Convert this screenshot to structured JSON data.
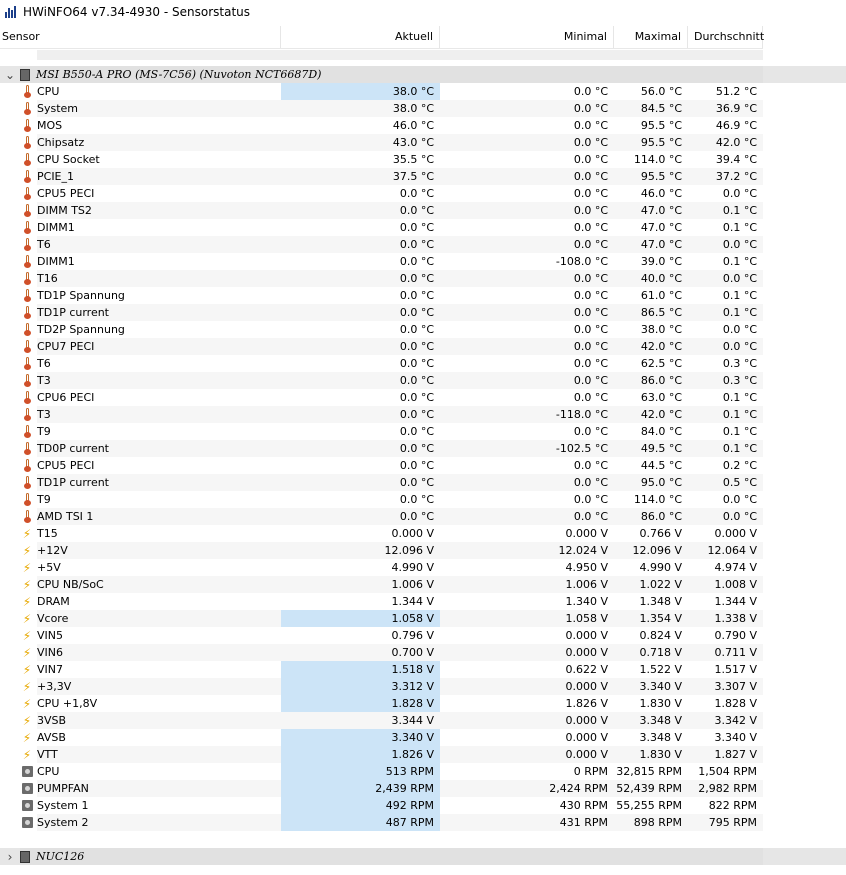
{
  "window": {
    "title": "HWiNFO64 v7.34-4930 - Sensorstatus"
  },
  "columns": {
    "sensor": "Sensor",
    "current": "Aktuell",
    "min": "Minimal",
    "max": "Maximal",
    "avg": "Durchschnitt"
  },
  "group1": {
    "name": "MSI B550-A PRO (MS-7C56) (Nuvoton NCT6687D)",
    "expanded": true
  },
  "group2": {
    "name": "NUC126",
    "expanded": false
  },
  "rows": [
    {
      "icon": "thermometer-icon",
      "name": "CPU",
      "cur": "38.0 °C",
      "min": "0.0 °C",
      "max": "56.0 °C",
      "avg": "51.2 °C",
      "hl": true
    },
    {
      "icon": "thermometer-icon",
      "name": "System",
      "cur": "38.0 °C",
      "min": "0.0 °C",
      "max": "84.5 °C",
      "avg": "36.9 °C",
      "hl": false
    },
    {
      "icon": "thermometer-icon",
      "name": "MOS",
      "cur": "46.0 °C",
      "min": "0.0 °C",
      "max": "95.5 °C",
      "avg": "46.9 °C",
      "hl": false
    },
    {
      "icon": "thermometer-icon",
      "name": "Chipsatz",
      "cur": "43.0 °C",
      "min": "0.0 °C",
      "max": "95.5 °C",
      "avg": "42.0 °C",
      "hl": false
    },
    {
      "icon": "thermometer-icon",
      "name": "CPU Socket",
      "cur": "35.5 °C",
      "min": "0.0 °C",
      "max": "114.0 °C",
      "avg": "39.4 °C",
      "hl": false
    },
    {
      "icon": "thermometer-icon",
      "name": "PCIE_1",
      "cur": "37.5 °C",
      "min": "0.0 °C",
      "max": "95.5 °C",
      "avg": "37.2 °C",
      "hl": false
    },
    {
      "icon": "thermometer-icon",
      "name": "CPU5 PECI",
      "cur": "0.0 °C",
      "min": "0.0 °C",
      "max": "46.0 °C",
      "avg": "0.0 °C",
      "hl": false
    },
    {
      "icon": "thermometer-icon",
      "name": "DIMM TS2",
      "cur": "0.0 °C",
      "min": "0.0 °C",
      "max": "47.0 °C",
      "avg": "0.1 °C",
      "hl": false
    },
    {
      "icon": "thermometer-icon",
      "name": "DIMM1",
      "cur": "0.0 °C",
      "min": "0.0 °C",
      "max": "47.0 °C",
      "avg": "0.1 °C",
      "hl": false
    },
    {
      "icon": "thermometer-icon",
      "name": "T6",
      "cur": "0.0 °C",
      "min": "0.0 °C",
      "max": "47.0 °C",
      "avg": "0.0 °C",
      "hl": false
    },
    {
      "icon": "thermometer-icon",
      "name": "DIMM1",
      "cur": "0.0 °C",
      "min": "-108.0 °C",
      "max": "39.0 °C",
      "avg": "0.1 °C",
      "hl": false
    },
    {
      "icon": "thermometer-icon",
      "name": "T16",
      "cur": "0.0 °C",
      "min": "0.0 °C",
      "max": "40.0 °C",
      "avg": "0.0 °C",
      "hl": false
    },
    {
      "icon": "thermometer-icon",
      "name": "TD1P Spannung",
      "cur": "0.0 °C",
      "min": "0.0 °C",
      "max": "61.0 °C",
      "avg": "0.1 °C",
      "hl": false
    },
    {
      "icon": "thermometer-icon",
      "name": "TD1P current",
      "cur": "0.0 °C",
      "min": "0.0 °C",
      "max": "86.5 °C",
      "avg": "0.1 °C",
      "hl": false
    },
    {
      "icon": "thermometer-icon",
      "name": "TD2P Spannung",
      "cur": "0.0 °C",
      "min": "0.0 °C",
      "max": "38.0 °C",
      "avg": "0.0 °C",
      "hl": false
    },
    {
      "icon": "thermometer-icon",
      "name": "CPU7 PECI",
      "cur": "0.0 °C",
      "min": "0.0 °C",
      "max": "42.0 °C",
      "avg": "0.0 °C",
      "hl": false
    },
    {
      "icon": "thermometer-icon",
      "name": "T6",
      "cur": "0.0 °C",
      "min": "0.0 °C",
      "max": "62.5 °C",
      "avg": "0.3 °C",
      "hl": false
    },
    {
      "icon": "thermometer-icon",
      "name": "T3",
      "cur": "0.0 °C",
      "min": "0.0 °C",
      "max": "86.0 °C",
      "avg": "0.3 °C",
      "hl": false
    },
    {
      "icon": "thermometer-icon",
      "name": "CPU6 PECI",
      "cur": "0.0 °C",
      "min": "0.0 °C",
      "max": "63.0 °C",
      "avg": "0.1 °C",
      "hl": false
    },
    {
      "icon": "thermometer-icon",
      "name": "T3",
      "cur": "0.0 °C",
      "min": "-118.0 °C",
      "max": "42.0 °C",
      "avg": "0.1 °C",
      "hl": false
    },
    {
      "icon": "thermometer-icon",
      "name": "T9",
      "cur": "0.0 °C",
      "min": "0.0 °C",
      "max": "84.0 °C",
      "avg": "0.1 °C",
      "hl": false
    },
    {
      "icon": "thermometer-icon",
      "name": "TD0P current",
      "cur": "0.0 °C",
      "min": "-102.5 °C",
      "max": "49.5 °C",
      "avg": "0.1 °C",
      "hl": false
    },
    {
      "icon": "thermometer-icon",
      "name": "CPU5 PECI",
      "cur": "0.0 °C",
      "min": "0.0 °C",
      "max": "44.5 °C",
      "avg": "0.2 °C",
      "hl": false
    },
    {
      "icon": "thermometer-icon",
      "name": "TD1P current",
      "cur": "0.0 °C",
      "min": "0.0 °C",
      "max": "95.0 °C",
      "avg": "0.5 °C",
      "hl": false
    },
    {
      "icon": "thermometer-icon",
      "name": "T9",
      "cur": "0.0 °C",
      "min": "0.0 °C",
      "max": "114.0 °C",
      "avg": "0.0 °C",
      "hl": false
    },
    {
      "icon": "thermometer-icon",
      "name": "AMD TSI 1",
      "cur": "0.0 °C",
      "min": "0.0 °C",
      "max": "86.0 °C",
      "avg": "0.0 °C",
      "hl": false
    },
    {
      "icon": "voltage-icon",
      "name": "T15",
      "cur": "0.000 V",
      "min": "0.000 V",
      "max": "0.766 V",
      "avg": "0.000 V",
      "hl": false
    },
    {
      "icon": "voltage-icon",
      "name": "+12V",
      "cur": "12.096 V",
      "min": "12.024 V",
      "max": "12.096 V",
      "avg": "12.064 V",
      "hl": false
    },
    {
      "icon": "voltage-icon",
      "name": "+5V",
      "cur": "4.990 V",
      "min": "4.950 V",
      "max": "4.990 V",
      "avg": "4.974 V",
      "hl": false
    },
    {
      "icon": "voltage-icon",
      "name": "CPU NB/SoC",
      "cur": "1.006 V",
      "min": "1.006 V",
      "max": "1.022 V",
      "avg": "1.008 V",
      "hl": false
    },
    {
      "icon": "voltage-icon",
      "name": "DRAM",
      "cur": "1.344 V",
      "min": "1.340 V",
      "max": "1.348 V",
      "avg": "1.344 V",
      "hl": false
    },
    {
      "icon": "voltage-icon",
      "name": "Vcore",
      "cur": "1.058 V",
      "min": "1.058 V",
      "max": "1.354 V",
      "avg": "1.338 V",
      "hl": true
    },
    {
      "icon": "voltage-icon",
      "name": "VIN5",
      "cur": "0.796 V",
      "min": "0.000 V",
      "max": "0.824 V",
      "avg": "0.790 V",
      "hl": false
    },
    {
      "icon": "voltage-icon",
      "name": "VIN6",
      "cur": "0.700 V",
      "min": "0.000 V",
      "max": "0.718 V",
      "avg": "0.711 V",
      "hl": false
    },
    {
      "icon": "voltage-icon",
      "name": "VIN7",
      "cur": "1.518 V",
      "min": "0.622 V",
      "max": "1.522 V",
      "avg": "1.517 V",
      "hl": true
    },
    {
      "icon": "voltage-icon",
      "name": "+3,3V",
      "cur": "3.312 V",
      "min": "0.000 V",
      "max": "3.340 V",
      "avg": "3.307 V",
      "hl": true
    },
    {
      "icon": "voltage-icon",
      "name": "CPU +1,8V",
      "cur": "1.828 V",
      "min": "1.826 V",
      "max": "1.830 V",
      "avg": "1.828 V",
      "hl": true
    },
    {
      "icon": "voltage-icon",
      "name": "3VSB",
      "cur": "3.344 V",
      "min": "0.000 V",
      "max": "3.348 V",
      "avg": "3.342 V",
      "hl": false
    },
    {
      "icon": "voltage-icon",
      "name": "AVSB",
      "cur": "3.340 V",
      "min": "0.000 V",
      "max": "3.348 V",
      "avg": "3.340 V",
      "hl": true
    },
    {
      "icon": "voltage-icon",
      "name": "VTT",
      "cur": "1.826 V",
      "min": "0.000 V",
      "max": "1.830 V",
      "avg": "1.827 V",
      "hl": true
    },
    {
      "icon": "fan-icon",
      "name": "CPU",
      "cur": "513 RPM",
      "min": "0 RPM",
      "max": "32,815 RPM",
      "avg": "1,504 RPM",
      "hl": true
    },
    {
      "icon": "fan-icon",
      "name": "PUMPFAN",
      "cur": "2,439 RPM",
      "min": "2,424 RPM",
      "max": "52,439 RPM",
      "avg": "2,982 RPM",
      "hl": true
    },
    {
      "icon": "fan-icon",
      "name": "System 1",
      "cur": "492 RPM",
      "min": "430 RPM",
      "max": "55,255 RPM",
      "avg": "822 RPM",
      "hl": true
    },
    {
      "icon": "fan-icon",
      "name": "System 2",
      "cur": "487 RPM",
      "min": "431 RPM",
      "max": "898 RPM",
      "avg": "795 RPM",
      "hl": true
    }
  ]
}
